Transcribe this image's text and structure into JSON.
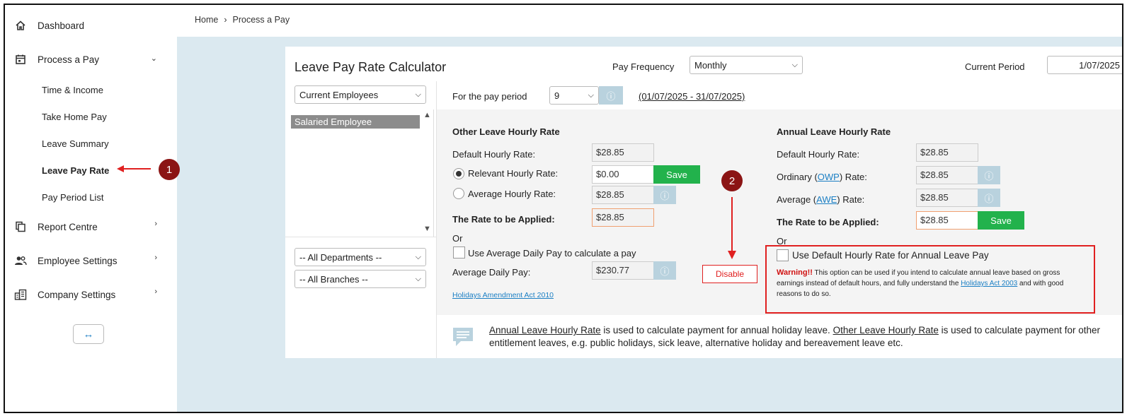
{
  "sidebar": {
    "items": [
      {
        "label": "Dashboard",
        "icon": "home-icon"
      },
      {
        "label": "Process a Pay",
        "icon": "calendar-icon"
      },
      {
        "label": "Report Centre",
        "icon": "report-icon"
      },
      {
        "label": "Employee Settings",
        "icon": "users-icon"
      },
      {
        "label": "Company Settings",
        "icon": "building-icon"
      }
    ],
    "sub_items": [
      "Time & Income",
      "Take Home Pay",
      "Leave Summary",
      "Leave Pay Rate",
      "Pay Period List"
    ],
    "collapse_glyph": "↔"
  },
  "breadcrumb": {
    "home": "Home",
    "sep": "›",
    "current": "Process a Pay"
  },
  "page": {
    "title": "Leave Pay Rate Calculator",
    "pay_frequency_label": "Pay Frequency",
    "pay_frequency_value": "Monthly",
    "current_period_label": "Current Period",
    "current_period_value": "1/07/2025"
  },
  "filters": {
    "employees": "Current Employees",
    "departments": "-- All Departments --",
    "branches": "-- All Branches --"
  },
  "employee_list": [
    "Salaried Employee"
  ],
  "period": {
    "label": "For the pay period",
    "value": "9",
    "range": "(01/07/2025 - 31/07/2025)"
  },
  "other_leave": {
    "heading": "Other Leave Hourly Rate",
    "default_label": "Default Hourly Rate:",
    "default_value": "$28.85",
    "relevant_label": "Relevant Hourly Rate:",
    "relevant_value": "$0.00",
    "save_label": "Save",
    "average_label": "Average Hourly Rate:",
    "average_value": "$28.85",
    "applied_label": "The Rate to be Applied:",
    "applied_value": "$28.85",
    "or": "Or",
    "use_adp_label": "Use Average Daily Pay to calculate a pay",
    "adp_label": "Average Daily Pay:",
    "adp_value": "$230.77",
    "act_link": "Holidays Amendment Act 2010"
  },
  "annual_leave": {
    "heading": "Annual Leave Hourly Rate",
    "default_label": "Default Hourly Rate:",
    "default_value": "$28.85",
    "ordinary_pre": "Ordinary (",
    "ordinary_link": "OWP",
    "ordinary_post": ") Rate:",
    "ordinary_value": "$28.85",
    "average_pre": "Average (",
    "average_link": "AWE",
    "average_post": ") Rate:",
    "average_value": "$28.85",
    "applied_label": "The Rate to be Applied:",
    "applied_value": "$28.85",
    "save_label": "Save",
    "or": "Or",
    "use_default_label": "Use Default Hourly Rate for Annual Leave Pay",
    "warning_title": "Warning!!",
    "warning_text_1": " This option can be used if you intend to calculate annual leave based on gross earnings instead of default hours, and fully understand the ",
    "warning_link": "Holidays Act 2003",
    "warning_text_2": " and with good reasons to do so."
  },
  "annotations": {
    "badge1": "1",
    "badge2": "2",
    "disable_label": "Disable"
  },
  "note": {
    "annual_term": "Annual Leave Hourly Rate",
    "annual_text": " is used to calculate payment for annual holiday leave. ",
    "other_term": "Other Leave Hourly Rate",
    "other_text": " is used to calculate payment for other entitlement leaves, e.g. public holidays, sick leave, alternative holiday and bereavement leave etc."
  },
  "colors": {
    "accent_green": "#22b24c",
    "annotation_red": "#e02020",
    "badge_bg": "#8b1414",
    "link_blue": "#1b7fc4"
  }
}
